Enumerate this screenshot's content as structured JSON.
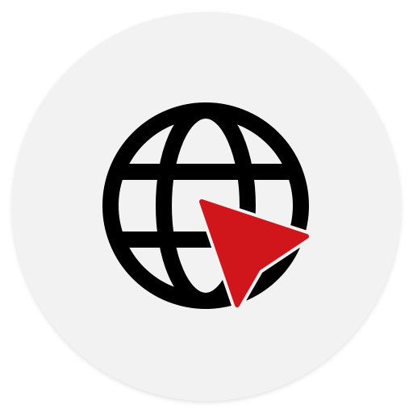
{
  "icon": {
    "badge": "circle-badge",
    "globe": "globe-icon",
    "cursor": "cursor-arrow-icon"
  },
  "colors": {
    "background": "#ffffff",
    "badge": "#f2f2f2",
    "globe_stroke": "#000000",
    "cursor_fill": "#d0161a"
  }
}
